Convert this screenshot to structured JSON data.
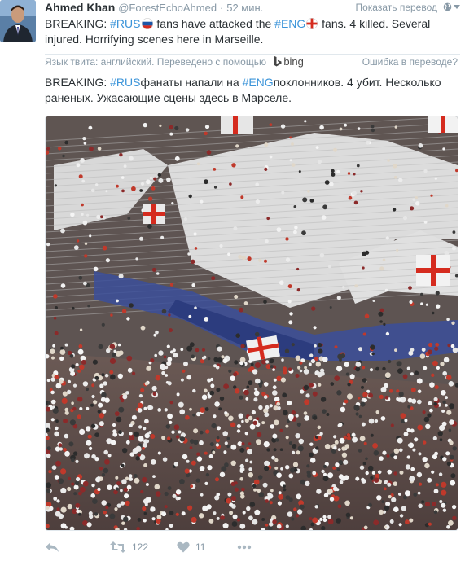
{
  "author": {
    "name": "Ahmed Khan",
    "handle": "@ForestEchoAhmed",
    "separator": "·",
    "time": "52 мин."
  },
  "translate_link": "Показать перевод",
  "tweet": {
    "t1": "BREAKING: ",
    "tag1": "#RUS",
    "t2": " fans have attacked the ",
    "tag2": "#ENG",
    "t3": " fans. 4 killed. Several injured. Horrifying scenes here in Marseille."
  },
  "translation": {
    "info_label": "Язык твита: английский. Переведено с помощью",
    "provider": "bing",
    "error_link": "Ошибка в переводе?",
    "t1": "BREAKING: ",
    "tag1": "#RUS",
    "t2": "фанаты напали на ",
    "tag2": "#ENG",
    "t3": "поклонников. 4 убит. Несколько раненых. Ужасающие сцены здесь в Марселе."
  },
  "actions": {
    "retweets": "122",
    "likes": "11"
  },
  "colors": {
    "hashtag": "#3b94d9",
    "meta": "#8899a6",
    "text": "#292f33"
  },
  "icons": [
    "avatar",
    "globe-icon",
    "caret-down-icon",
    "russia-flag-icon",
    "england-flag-icon",
    "bing-logo-icon",
    "reply-icon",
    "retweet-icon",
    "like-icon",
    "more-icon"
  ]
}
